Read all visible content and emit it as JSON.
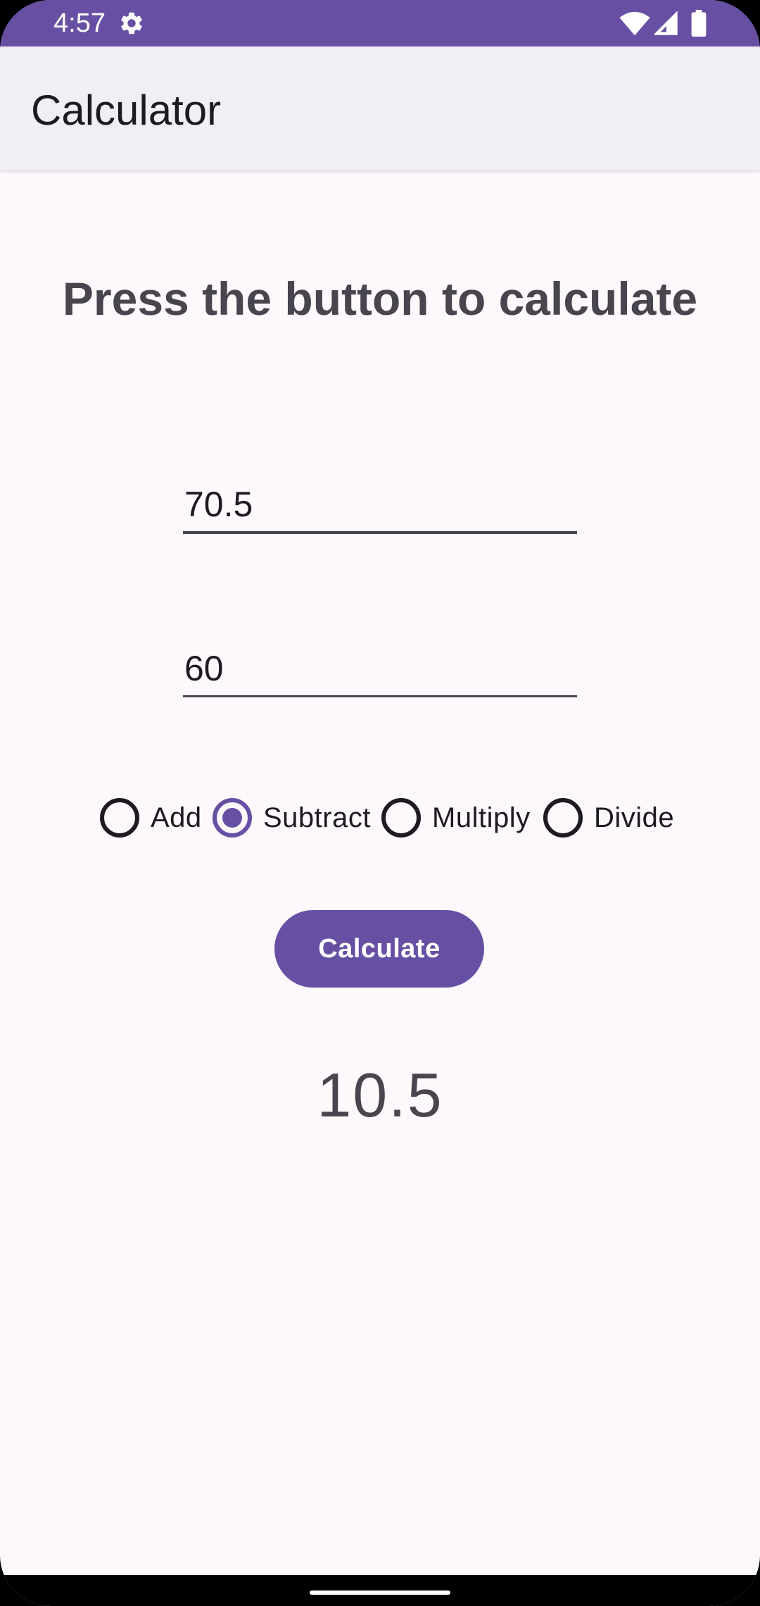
{
  "status_bar": {
    "time": "4:57",
    "icons": [
      "gear-icon",
      "wifi-icon",
      "signal-icon",
      "battery-icon"
    ],
    "color": "#6750a4"
  },
  "app_bar": {
    "title": "Calculator"
  },
  "main": {
    "heading": "Press the button to calculate",
    "first_number": "70.5",
    "second_number": "60",
    "operations": [
      {
        "label": "Add",
        "selected": false
      },
      {
        "label": "Subtract",
        "selected": true
      },
      {
        "label": "Multiply",
        "selected": false
      },
      {
        "label": "Divide",
        "selected": false
      }
    ],
    "calculate_label": "Calculate",
    "result": "10.5"
  },
  "colors": {
    "accent": "#6750a4",
    "background": "#fdf8fc",
    "app_bar": "#f2eef6",
    "text": "#1d1b20",
    "muted_text": "#49454f"
  }
}
